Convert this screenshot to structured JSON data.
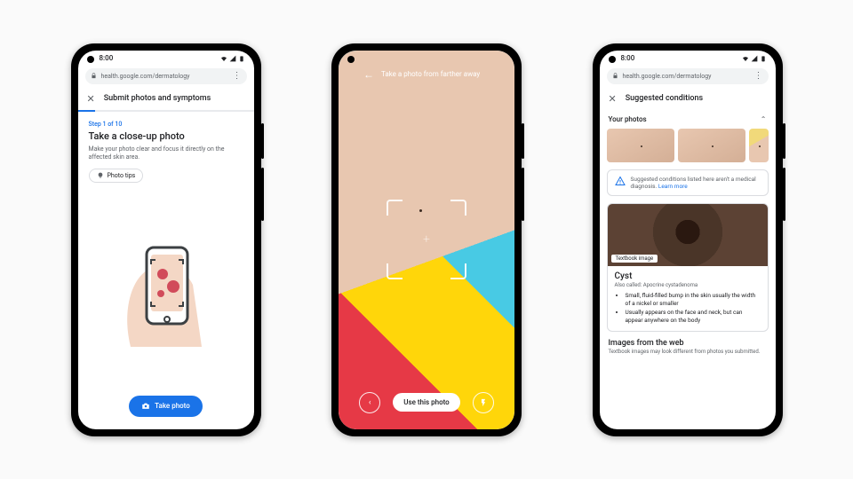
{
  "status": {
    "time": "8:00"
  },
  "url_bar": {
    "url": "health.google.com/dermatology"
  },
  "phone1": {
    "title": "Submit photos and symptoms",
    "step_label": "Step 1 of 10",
    "heading": "Take a close-up photo",
    "subtext": "Make your photo clear and focus it directly on the affected skin area.",
    "chip_label": "Photo tips",
    "primary_btn": "Take photo"
  },
  "phone2": {
    "hint": "Take a photo from farther away",
    "use_btn": "Use this photo"
  },
  "phone3": {
    "title": "Suggested conditions",
    "your_photos": "Your photos",
    "notice_text": "Suggested conditions listed here aren't a medical diagnosis.",
    "notice_link": "Learn more",
    "card": {
      "tag": "Textbook image",
      "name": "Cyst",
      "aka": "Also called: Apocrine cystadenoma",
      "bullets": [
        "Small, fluid-filled bump in the skin usually the width of a nickel or smaller",
        "Usually appears on the face and neck, but can appear anywhere on the body"
      ]
    },
    "web_heading": "Images from the web",
    "web_sub": "Textbook images may look different from photos you submitted."
  }
}
